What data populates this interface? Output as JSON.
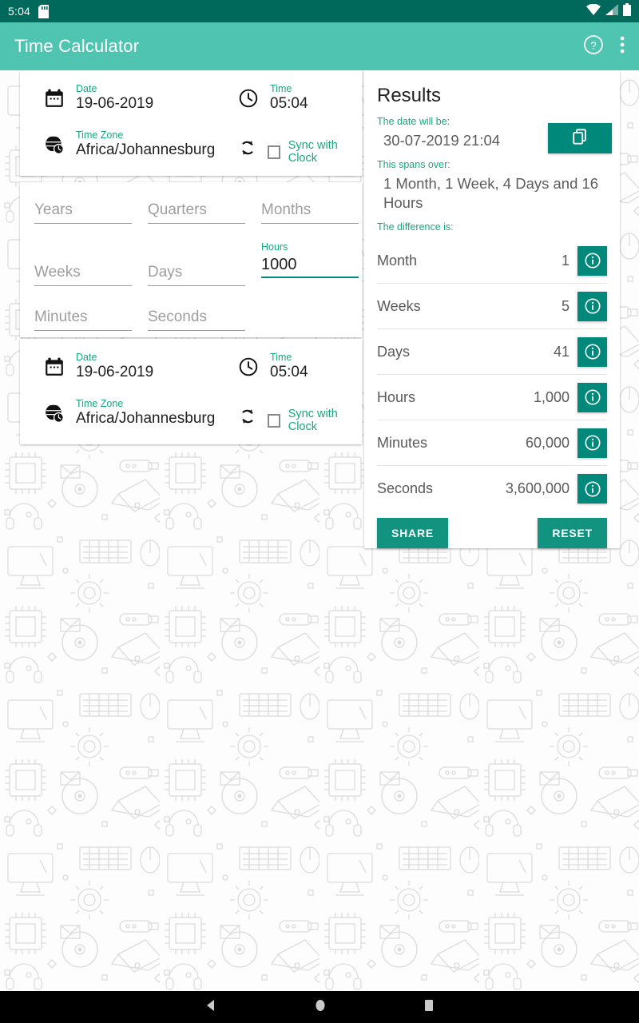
{
  "status_bar": {
    "clock": "5:04",
    "icons": [
      "sd-card-icon",
      "wifi-icon",
      "cellular-signal-icon",
      "battery-icon"
    ]
  },
  "app_bar": {
    "title": "Time Calculator",
    "help_icon": "help-circle-icon",
    "overflow_icon": "more-vertical-icon"
  },
  "start_card": {
    "date_label": "Date",
    "date_value": "19-06-2019",
    "time_label": "Time",
    "time_value": "05:04",
    "timezone_label": "Time Zone",
    "timezone_value": "Africa/Johannesburg",
    "sync_label": "Sync with Clock",
    "sync_checked": false
  },
  "end_card": {
    "date_label": "Date",
    "date_value": "19-06-2019",
    "time_label": "Time",
    "time_value": "05:04",
    "timezone_label": "Time Zone",
    "timezone_value": "Africa/Johannesburg",
    "sync_label": "Sync with Clock",
    "sync_checked": false
  },
  "duration_inputs": [
    {
      "name": "years",
      "placeholder": "Years",
      "value": ""
    },
    {
      "name": "quarters",
      "placeholder": "Quarters",
      "value": ""
    },
    {
      "name": "months",
      "placeholder": "Months",
      "value": ""
    },
    {
      "name": "weeks",
      "placeholder": "Weeks",
      "value": ""
    },
    {
      "name": "days",
      "placeholder": "Days",
      "value": ""
    },
    {
      "name": "hours",
      "placeholder": "Hours",
      "value": "1000",
      "label": "Hours",
      "focused": true
    },
    {
      "name": "minutes",
      "placeholder": "Minutes",
      "value": ""
    },
    {
      "name": "seconds",
      "placeholder": "Seconds",
      "value": ""
    }
  ],
  "results": {
    "title": "Results",
    "date_will_be_label": "The date will be:",
    "date_will_be_value": "30-07-2019 21:04",
    "copy_icon": "copy-icon",
    "spans_over_label": "This spans over:",
    "spans_over_value": "1 Month, 1 Week, 4 Days and 16 Hours",
    "difference_label": "The difference is:",
    "rows": [
      {
        "name": "Month",
        "value": "1"
      },
      {
        "name": "Weeks",
        "value": "5"
      },
      {
        "name": "Days",
        "value": "41"
      },
      {
        "name": "Hours",
        "value": "1,000"
      },
      {
        "name": "Minutes",
        "value": "60,000"
      },
      {
        "name": "Seconds",
        "value": "3,600,000"
      }
    ],
    "info_icon": "info-circle-icon",
    "share_label": "SHARE",
    "reset_label": "RESET"
  },
  "nav_bar": {
    "back_icon": "nav-back-icon",
    "home_icon": "nav-home-icon",
    "recents_icon": "nav-recents-icon"
  },
  "colors": {
    "status_bar": "#00695C",
    "app_bar": "#4EC4B1",
    "accent_green": "#1AA67F",
    "button_green": "#00897B",
    "flat_button_green": "#12937F"
  }
}
